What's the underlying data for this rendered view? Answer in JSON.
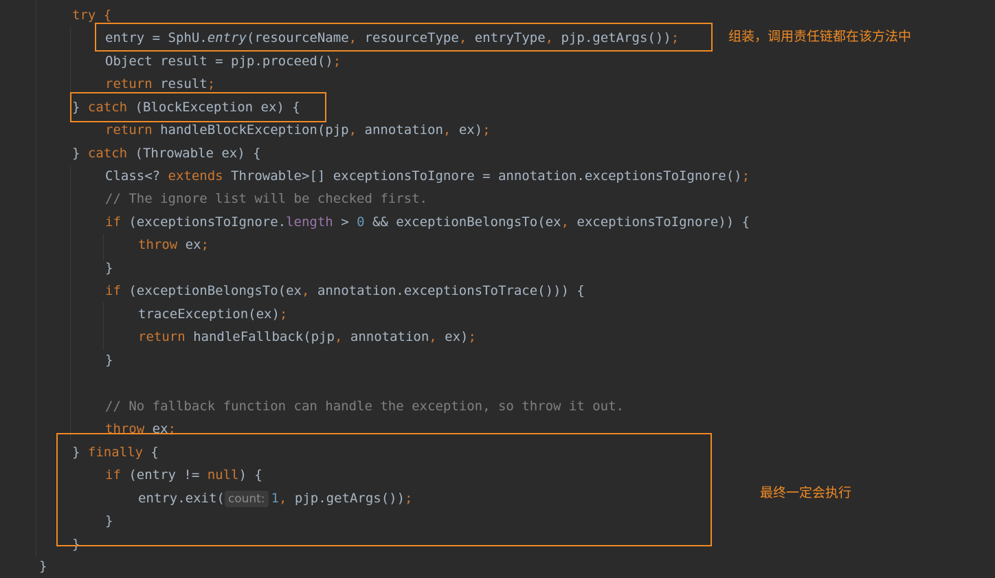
{
  "code": {
    "try": "try {",
    "l2": {
      "a": "entry = SphU.",
      "fn": "entry",
      "b": "(resourceName",
      "c": " resourceType",
      "d": " entryType",
      "e": " pjp.getArgs())"
    },
    "l3": {
      "a": "Object result = pjp.proceed()"
    },
    "l4": {
      "kw": "return",
      "a": " result"
    },
    "l5": {
      "a": "} ",
      "kw": "catch",
      "b": " (BlockException ex) {"
    },
    "l6": {
      "kw": "return",
      "a": " handleBlockException(pjp",
      "b": " annotation",
      "c": " ex)"
    },
    "l7": {
      "a": "} ",
      "kw": "catch",
      "b": " (Throwable ex) {"
    },
    "l8": {
      "a": "Class<? ",
      "kw": "extends",
      "b": " Throwable>[] exceptionsToIgnore = annotation.exceptionsToIgnore()"
    },
    "l9": {
      "comment": "// The ignore list will be checked first."
    },
    "l10": {
      "kw": "if",
      "a": " (exceptionsToIgnore.",
      "field": "length",
      "b": " > ",
      "num": "0",
      "c": " && exceptionBelongsTo(ex",
      "d": " exceptionsToIgnore)) {"
    },
    "l11": {
      "kw": "throw",
      "a": " ex"
    },
    "l12": {
      "a": "}"
    },
    "l13": {
      "kw": "if",
      "a": " (exceptionBelongsTo(ex",
      "b": " annotation.exceptionsToTrace())) {"
    },
    "l14": {
      "a": "traceException(ex)"
    },
    "l15": {
      "kw": "return",
      "a": " handleFallback(pjp",
      "b": " annotation",
      "c": " ex)"
    },
    "l16": {
      "a": "}"
    },
    "l18": {
      "comment": "// No fallback function can handle the exception, so throw it out."
    },
    "l19": {
      "kw": "throw",
      "a": " ex"
    },
    "l20": {
      "a": "} ",
      "kw": "finally",
      "b": " {"
    },
    "l21": {
      "kw": "if",
      "a": " (entry != ",
      "kw2": "null",
      "b": ") {"
    },
    "l22": {
      "a": "entry.exit(",
      "hint": "count:",
      "num": "1",
      "b": " pjp.getArgs())"
    },
    "l23": {
      "a": "}"
    },
    "l24": {
      "a": "}"
    },
    "l25": {
      "a": "}"
    },
    "comma": ",",
    "semicolon": ";"
  },
  "annotations": {
    "entry_note": "组装，调用责任链都在该方法中",
    "finally_note": "最终一定会执行"
  },
  "colors": {
    "background": "#2b2b2b",
    "keyword": "#cc7832",
    "text": "#a9b7c6",
    "comment": "#808080",
    "number": "#6897bb",
    "field": "#9876aa",
    "highlight_box": "#f08a24"
  }
}
